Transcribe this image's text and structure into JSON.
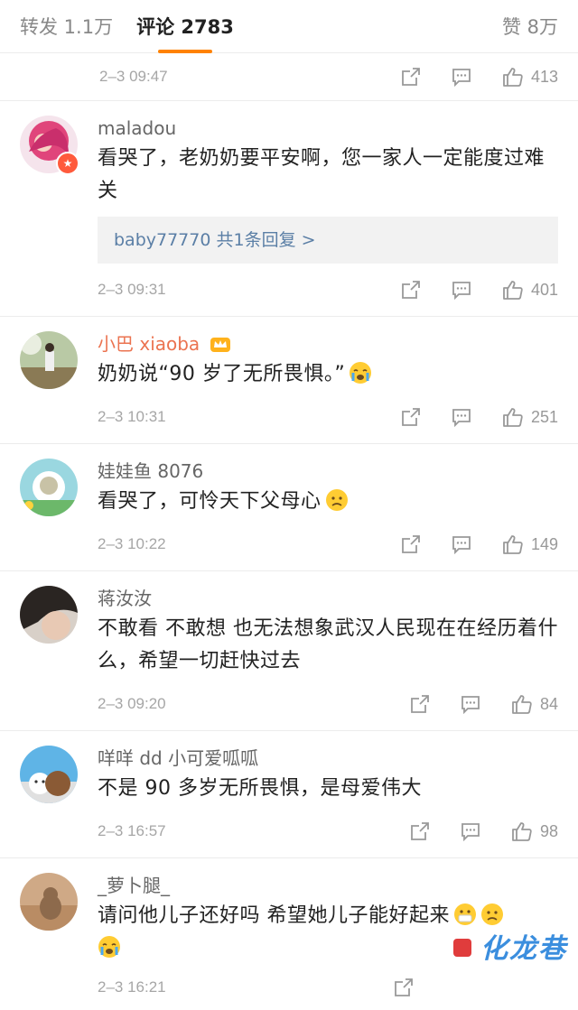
{
  "tabs": {
    "repost": "转发 1.1万",
    "comments": "评论 2783",
    "likes": "赞 8万"
  },
  "top_post": {
    "time": "2–3 09:47",
    "likes": "413"
  },
  "comments": [
    {
      "name": "maladou",
      "text": "看哭了，老奶奶要平安啊，您一家人一定能度过难关",
      "reply": "baby77770  共1条回复 >",
      "time": "2–3 09:31",
      "likes": "401"
    },
    {
      "name": "小巴 xiaoba",
      "text": "奶奶说“90 岁了无所畏惧。”",
      "time": "2–3 10:31",
      "likes": "251"
    },
    {
      "name": "娃娃鱼 8076",
      "text": "看哭了，可怜天下父母心",
      "time": "2–3 10:22",
      "likes": "149"
    },
    {
      "name": "蒋汝汝",
      "text": "不敢看 不敢想 也无法想象武汉人民现在在经历着什么，希望一切赶快过去",
      "time": "2–3 09:20",
      "likes": "84"
    },
    {
      "name": "咩咩 dd 小可爱呱呱",
      "text": "不是 90 多岁无所畏惧，是母爱伟大",
      "time": "2–3 16:57",
      "likes": "98"
    },
    {
      "name": "_萝卜腿_",
      "text": "请问他儿子还好吗 希望她儿子能好起来",
      "time": "2–3 16:21",
      "likes": ""
    }
  ],
  "watermark": "化龙巷",
  "colors": {
    "accent": "#ff8200",
    "vip_name": "#eb7350",
    "link": "#5b7fa6"
  },
  "icons": [
    "repost-icon",
    "comment-icon",
    "like-icon",
    "crying-emoji-icon",
    "sad-emoji-icon",
    "crown-icon"
  ]
}
